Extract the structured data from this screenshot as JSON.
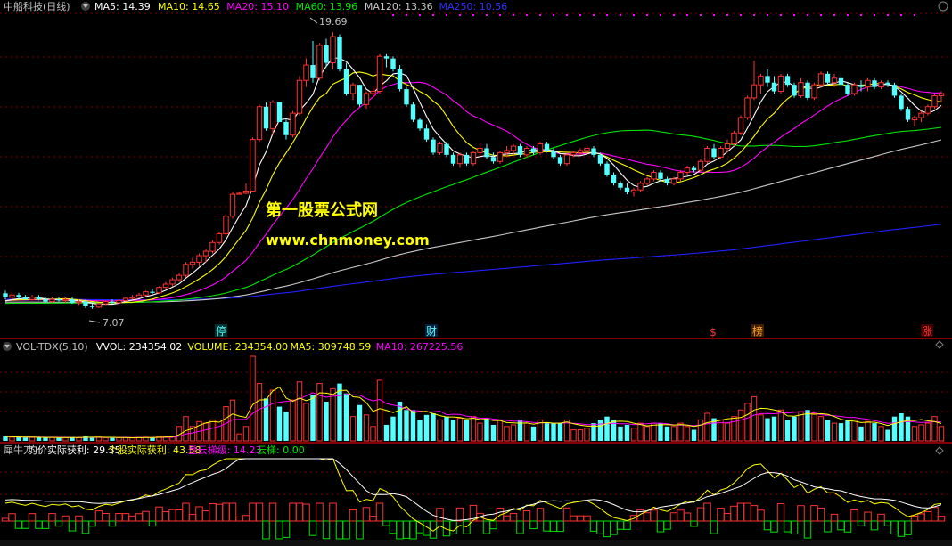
{
  "title": "中船科技(日线)",
  "colors": {
    "up": "#ff3232",
    "down": "#54ffff",
    "ma5": "#ffffff",
    "ma10": "#ffff00",
    "ma20": "#ff00ff",
    "ma60": "#00e600",
    "ma120": "#c8c8c8",
    "ma250": "#2020ff",
    "grid": "#800000"
  },
  "main_panel": {
    "ma_labels": [
      {
        "text": "MA5: 14.39",
        "color": "#ffffff"
      },
      {
        "text": "MA10: 14.65",
        "color": "#ffff00"
      },
      {
        "text": "MA20: 15.10",
        "color": "#ff00ff"
      },
      {
        "text": "MA60: 13.96",
        "color": "#00e600"
      },
      {
        "text": "MA120: 13.36",
        "color": "#c8c8c8"
      },
      {
        "text": "MA250: 10.56",
        "color": "#3030ff"
      }
    ],
    "high_label": "19.69",
    "low_label": "7.07",
    "markers": [
      {
        "text": "停",
        "color": "#54ffff"
      },
      {
        "text": "财",
        "color": "#54ffff"
      },
      {
        "text": "$",
        "color": "#ff3232"
      },
      {
        "text": "榜",
        "color": "#ffa020"
      },
      {
        "text": "涨",
        "color": "#ff3232"
      }
    ]
  },
  "watermark": {
    "line1": "第一股票公式网",
    "line2": "www.chnmoney.com"
  },
  "vol_panel": {
    "labels": [
      {
        "text": "VOL-TDX(5,10)",
        "color": "#c0c0c0"
      },
      {
        "text": "VVOL: 234354.02",
        "color": "#ffffff"
      },
      {
        "text": "VOLUME: 234354.00",
        "color": "#ffff00"
      },
      {
        "text": "MA5: 309748.59",
        "color": "#ffff00"
      },
      {
        "text": "MA10: 267225.56",
        "color": "#ff00ff"
      }
    ]
  },
  "ind_panel": {
    "labels": [
      {
        "text": "犀牛刀",
        "color": "#c0c0c0"
      },
      {
        "text": "均价实际获利: 29.35",
        "color": "#ffffff"
      },
      {
        "text": "个股实际获利: 43.58",
        "color": "#ffff00"
      },
      {
        "text": "登云梯级: 14.23",
        "color": "#ff00ff"
      },
      {
        "text": "云梯: 0.00",
        "color": "#00e600"
      }
    ]
  },
  "chart_data": {
    "type": "candlestick",
    "title": "中船科技(日线)",
    "ylim": [
      5.8,
      20.6
    ],
    "candles": [
      [
        7.78,
        7.9,
        7.5,
        7.6
      ],
      [
        7.6,
        7.8,
        7.5,
        7.7
      ],
      [
        7.7,
        7.8,
        7.5,
        7.6
      ],
      [
        7.6,
        7.7,
        7.45,
        7.5
      ],
      [
        7.5,
        7.7,
        7.45,
        7.6
      ],
      [
        7.6,
        7.7,
        7.45,
        7.5
      ],
      [
        7.5,
        7.6,
        7.35,
        7.4
      ],
      [
        7.4,
        7.6,
        7.35,
        7.5
      ],
      [
        7.5,
        7.6,
        7.4,
        7.45
      ],
      [
        7.45,
        7.6,
        7.35,
        7.5
      ],
      [
        7.5,
        7.6,
        7.3,
        7.35
      ],
      [
        7.35,
        7.5,
        7.25,
        7.4
      ],
      [
        7.4,
        7.5,
        7.1,
        7.2
      ],
      [
        7.2,
        7.3,
        7.07,
        7.15
      ],
      [
        7.15,
        7.35,
        7.1,
        7.3
      ],
      [
        7.3,
        7.45,
        7.25,
        7.4
      ],
      [
        7.4,
        7.5,
        7.3,
        7.35
      ],
      [
        7.35,
        7.5,
        7.3,
        7.45
      ],
      [
        7.45,
        7.6,
        7.4,
        7.55
      ],
      [
        7.55,
        7.7,
        7.5,
        7.6
      ],
      [
        7.6,
        7.8,
        7.55,
        7.7
      ],
      [
        7.7,
        7.9,
        7.65,
        7.85
      ],
      [
        7.85,
        8.0,
        7.75,
        7.8
      ],
      [
        7.8,
        8.1,
        7.75,
        8.05
      ],
      [
        8.05,
        8.3,
        8.0,
        8.2
      ],
      [
        8.2,
        8.5,
        8.1,
        8.4
      ],
      [
        8.4,
        8.7,
        8.3,
        8.6
      ],
      [
        8.6,
        9.2,
        8.5,
        9.1
      ],
      [
        9.1,
        9.4,
        8.9,
        9.2
      ],
      [
        9.2,
        9.6,
        9.0,
        9.5
      ],
      [
        9.5,
        9.8,
        9.2,
        9.7
      ],
      [
        9.7,
        10.2,
        9.6,
        10.1
      ],
      [
        10.1,
        10.6,
        10.0,
        10.5
      ],
      [
        10.5,
        11.4,
        10.4,
        11.3
      ],
      [
        11.3,
        12.4,
        11.2,
        12.3
      ],
      [
        12.3,
        12.4,
        12.3,
        12.35
      ],
      [
        12.35,
        12.8,
        12.3,
        12.45
      ],
      [
        12.45,
        14.9,
        12.4,
        14.8
      ],
      [
        14.8,
        16.4,
        14.7,
        16.3
      ],
      [
        16.3,
        16.5,
        15.2,
        15.3
      ],
      [
        15.3,
        16.6,
        15.0,
        16.5
      ],
      [
        16.5,
        16.5,
        15.6,
        15.6
      ],
      [
        15.6,
        15.7,
        14.8,
        15.0
      ],
      [
        15.0,
        16.1,
        14.9,
        16.0
      ],
      [
        16.0,
        17.7,
        15.9,
        17.5
      ],
      [
        17.5,
        18.5,
        17.2,
        18.2
      ],
      [
        18.2,
        19.3,
        17.4,
        17.6
      ],
      [
        17.6,
        19.2,
        17.5,
        19.1
      ],
      [
        19.1,
        19.4,
        18.1,
        18.3
      ],
      [
        18.3,
        19.69,
        18.0,
        19.5
      ],
      [
        19.5,
        19.6,
        17.9,
        18.0
      ],
      [
        18.0,
        18.3,
        16.8,
        16.9
      ],
      [
        16.9,
        17.4,
        16.6,
        17.3
      ],
      [
        17.3,
        17.3,
        16.3,
        16.4
      ],
      [
        16.4,
        17.0,
        16.2,
        16.9
      ],
      [
        16.9,
        17.2,
        16.7,
        17.0
      ],
      [
        17.0,
        18.7,
        16.9,
        18.6
      ],
      [
        18.6,
        18.7,
        18.1,
        18.5
      ],
      [
        18.5,
        18.6,
        17.9,
        18.0
      ],
      [
        18.0,
        18.2,
        17.0,
        17.1
      ],
      [
        17.1,
        17.2,
        16.3,
        16.4
      ],
      [
        16.4,
        16.5,
        15.6,
        15.7
      ],
      [
        15.7,
        15.8,
        15.2,
        15.3
      ],
      [
        15.3,
        15.5,
        14.7,
        14.8
      ],
      [
        14.8,
        14.9,
        14.1,
        14.2
      ],
      [
        14.2,
        14.7,
        14.1,
        14.6
      ],
      [
        14.6,
        14.7,
        14.0,
        14.1
      ],
      [
        14.1,
        14.2,
        13.6,
        13.7
      ],
      [
        13.7,
        14.2,
        13.5,
        14.1
      ],
      [
        14.1,
        14.2,
        13.6,
        13.7
      ],
      [
        13.7,
        14.3,
        13.6,
        14.2
      ],
      [
        14.2,
        14.6,
        14.0,
        14.4
      ],
      [
        14.4,
        14.6,
        13.9,
        14.0
      ],
      [
        14.0,
        14.2,
        13.7,
        13.8
      ],
      [
        13.8,
        14.3,
        13.7,
        14.2
      ],
      [
        14.2,
        14.5,
        14.0,
        14.3
      ],
      [
        14.3,
        14.6,
        14.1,
        14.5
      ],
      [
        14.5,
        14.6,
        14.0,
        14.1
      ],
      [
        14.1,
        14.5,
        14.0,
        14.4
      ],
      [
        14.4,
        14.5,
        14.1,
        14.2
      ],
      [
        14.2,
        14.7,
        14.1,
        14.6
      ],
      [
        14.6,
        14.7,
        14.2,
        14.3
      ],
      [
        14.3,
        14.4,
        13.9,
        14.0
      ],
      [
        14.0,
        14.1,
        13.6,
        13.7
      ],
      [
        13.7,
        14.2,
        13.6,
        14.1
      ],
      [
        14.1,
        14.3,
        14.0,
        14.2
      ],
      [
        14.2,
        14.4,
        14.1,
        14.3
      ],
      [
        14.3,
        14.5,
        14.1,
        14.4
      ],
      [
        14.4,
        14.5,
        14.0,
        14.1
      ],
      [
        14.1,
        14.2,
        13.6,
        13.7
      ],
      [
        13.7,
        13.8,
        13.1,
        13.2
      ],
      [
        13.2,
        13.3,
        12.7,
        12.8
      ],
      [
        12.8,
        12.9,
        12.5,
        12.6
      ],
      [
        12.6,
        12.8,
        12.3,
        12.4
      ],
      [
        12.4,
        12.6,
        12.2,
        12.5
      ],
      [
        12.5,
        12.9,
        12.4,
        12.8
      ],
      [
        12.8,
        13.1,
        12.7,
        13.0
      ],
      [
        13.0,
        13.4,
        12.9,
        13.3
      ],
      [
        13.3,
        13.4,
        12.9,
        13.0
      ],
      [
        13.0,
        13.1,
        12.7,
        12.8
      ],
      [
        12.8,
        13.1,
        12.7,
        13.0
      ],
      [
        13.0,
        13.4,
        12.9,
        13.3
      ],
      [
        13.3,
        13.6,
        13.2,
        13.5
      ],
      [
        13.5,
        13.6,
        13.3,
        13.4
      ],
      [
        13.4,
        13.9,
        13.3,
        13.8
      ],
      [
        13.8,
        14.5,
        13.7,
        14.4
      ],
      [
        14.4,
        14.6,
        13.9,
        14.0
      ],
      [
        14.0,
        14.5,
        13.9,
        14.4
      ],
      [
        14.4,
        14.8,
        14.2,
        14.6
      ],
      [
        14.6,
        15.2,
        14.5,
        15.1
      ],
      [
        15.1,
        15.9,
        15.0,
        15.8
      ],
      [
        15.8,
        16.8,
        15.7,
        16.7
      ],
      [
        16.7,
        18.4,
        16.6,
        17.3
      ],
      [
        17.3,
        17.8,
        16.9,
        17.7
      ],
      [
        17.7,
        18.0,
        17.2,
        17.4
      ],
      [
        17.4,
        17.7,
        16.9,
        17.0
      ],
      [
        17.0,
        17.8,
        16.9,
        17.7
      ],
      [
        17.7,
        17.8,
        17.2,
        17.3
      ],
      [
        17.3,
        17.4,
        16.7,
        16.8
      ],
      [
        16.8,
        17.6,
        16.7,
        17.4
      ],
      [
        17.4,
        17.5,
        16.6,
        16.7
      ],
      [
        16.7,
        17.4,
        16.6,
        17.3
      ],
      [
        17.3,
        17.9,
        17.2,
        17.8
      ],
      [
        17.8,
        17.9,
        17.3,
        17.4
      ],
      [
        17.4,
        17.8,
        17.2,
        17.6
      ],
      [
        17.6,
        17.7,
        17.2,
        17.3
      ],
      [
        17.3,
        17.4,
        16.8,
        16.9
      ],
      [
        16.9,
        17.4,
        16.8,
        17.3
      ],
      [
        17.3,
        17.5,
        17.0,
        17.2
      ],
      [
        17.2,
        17.6,
        17.0,
        17.5
      ],
      [
        17.5,
        17.6,
        17.1,
        17.2
      ],
      [
        17.2,
        17.5,
        17.1,
        17.4
      ],
      [
        17.4,
        17.5,
        17.2,
        17.3
      ],
      [
        17.3,
        17.4,
        16.7,
        16.8
      ],
      [
        16.8,
        16.9,
        16.1,
        16.2
      ],
      [
        16.2,
        16.3,
        15.6,
        15.7
      ],
      [
        15.7,
        15.9,
        15.4,
        15.8
      ],
      [
        15.8,
        16.1,
        15.6,
        16.0
      ],
      [
        16.0,
        16.4,
        15.9,
        16.3
      ],
      [
        16.3,
        16.9,
        16.2,
        16.8
      ],
      [
        16.8,
        17.0,
        16.5,
        16.9
      ]
    ]
  }
}
